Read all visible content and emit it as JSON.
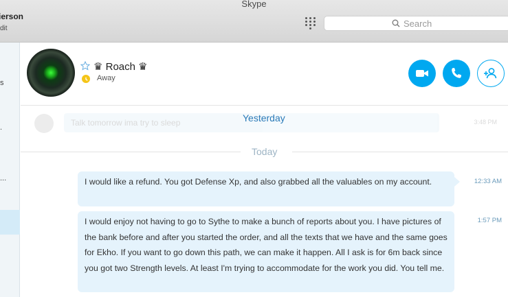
{
  "window": {
    "title": "Skype"
  },
  "account": {
    "name_fragment": "ierson",
    "sub_fragment": "dit"
  },
  "search": {
    "placeholder": "Search"
  },
  "sidebar": {
    "items": [
      {
        "label": "s"
      },
      {
        "label": "."
      },
      {
        "label": "..."
      }
    ]
  },
  "contact": {
    "name": "♛ Roach ♛",
    "status": "Away",
    "status_color": "#f5c518",
    "favorite_icon": "star-outline-icon"
  },
  "actions": {
    "video_icon": "video-camera-icon",
    "call_icon": "phone-icon",
    "add_icon": "add-person-icon",
    "accent": "#00a8f0"
  },
  "chat": {
    "faded_message": {
      "text": "Talk tomorrow ima try to sleep",
      "time": "3:48 PM"
    },
    "yesterday_label": "Yesterday",
    "today_label": "Today",
    "messages": [
      {
        "text": "I would like a refund.  You got Defense Xp, and also grabbed all the valuables on my account.",
        "time": "12:33 AM"
      },
      {
        "text": "I would enjoy not having to go to Sythe to make a bunch of reports about you.  I have pictures of the bank before and after you started the order, and all the texts that we have and the same goes for Ekho.  If you want to go down this path, we can make it happen.  All I ask is for 6m back since you got two Strength levels.  At least I'm trying to accommodate for the work you did.   You tell me.",
        "time": "1:57 PM"
      }
    ]
  }
}
